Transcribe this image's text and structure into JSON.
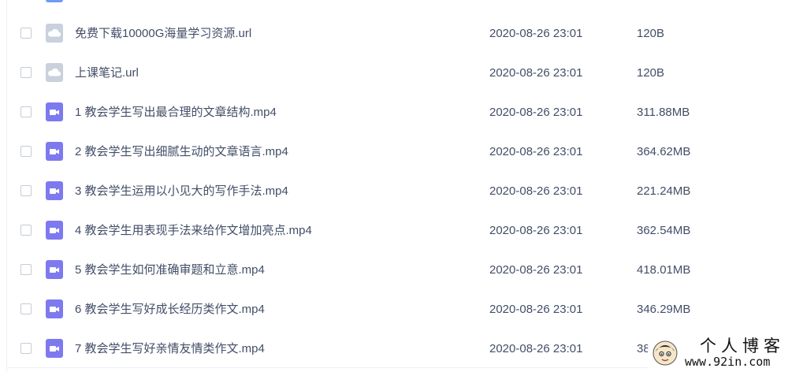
{
  "colors": {
    "cloud_icon": "#c9d1dc",
    "video_icon": "#7d7af0",
    "text": "#424e67",
    "partial_icon": "#6e9bf5"
  },
  "files": [
    {
      "name": "免费下载10000G海量学习资源.url",
      "date": "2020-08-26 23:01",
      "size": "120B",
      "icon": "cloud-link-icon"
    },
    {
      "name": "上课笔记.url",
      "date": "2020-08-26 23:01",
      "size": "120B",
      "icon": "cloud-link-icon"
    },
    {
      "name": "1 教会学生写出最合理的文章结构.mp4",
      "date": "2020-08-26 23:01",
      "size": "311.88MB",
      "icon": "video-file-icon"
    },
    {
      "name": "2 教会学生写出细腻生动的文章语言.mp4",
      "date": "2020-08-26 23:01",
      "size": "364.62MB",
      "icon": "video-file-icon"
    },
    {
      "name": "3 教会学生运用以小见大的写作手法.mp4",
      "date": "2020-08-26 23:01",
      "size": "221.24MB",
      "icon": "video-file-icon"
    },
    {
      "name": "4 教会学生用表现手法来给作文增加亮点.mp4",
      "date": "2020-08-26 23:01",
      "size": "362.54MB",
      "icon": "video-file-icon"
    },
    {
      "name": "5 教会学生如何准确审题和立意.mp4",
      "date": "2020-08-26 23:01",
      "size": "418.01MB",
      "icon": "video-file-icon"
    },
    {
      "name": "6 教会学生写好成长经历类作文.mp4",
      "date": "2020-08-26 23:01",
      "size": "346.29MB",
      "icon": "video-file-icon"
    },
    {
      "name": "7 教会学生写好亲情友情类作文.mp4",
      "date": "2020-08-26 23:01",
      "size": "38",
      "icon": "video-file-icon"
    }
  ],
  "watermark": {
    "title": "个人博客",
    "url": "www.92in.com"
  }
}
